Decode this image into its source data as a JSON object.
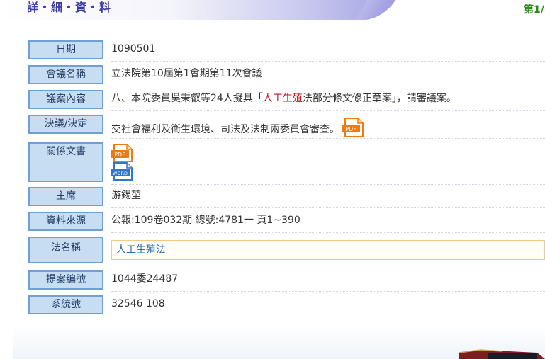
{
  "header": {
    "title": "詳・細・資・料",
    "page_indicator": "第1/"
  },
  "fields": {
    "date": {
      "label": "日期",
      "value": "1090501"
    },
    "meeting": {
      "label": "會議名稱",
      "value": "立法院第10屆第1會期第11次會議"
    },
    "content": {
      "label": "議案內容",
      "before": "八、本院委員吳秉叡等24人擬具「",
      "highlight": "人工生殖",
      "after": "法部分條文修正草案」，請審議案。"
    },
    "resolution": {
      "label": "決議/決定",
      "value": "交社會福利及衛生環境、司法及法制兩委員會審查。"
    },
    "related_docs": {
      "label": "關係文書"
    },
    "chair": {
      "label": "主席",
      "value": "游錫堃"
    },
    "source": {
      "label": "資料來源",
      "value": "公報:109卷032期 總號:4781一 頁1~390"
    },
    "law_name": {
      "label": "法名稱",
      "value": "人工生殖法"
    },
    "proposal_no": {
      "label": "提案編號",
      "value": "1044委24487"
    },
    "system_no": {
      "label": "系統號",
      "value": "32546 108"
    }
  },
  "icons": {
    "pdf_text": "PDF",
    "word_text": "WORD"
  },
  "colors": {
    "label_bg": "#c6ddf2",
    "label_border": "#6f9fd3",
    "highlight": "#c8141a",
    "link": "#2a6bb0",
    "pdf_orange": "#f07a12",
    "word_blue": "#2f77c8"
  }
}
